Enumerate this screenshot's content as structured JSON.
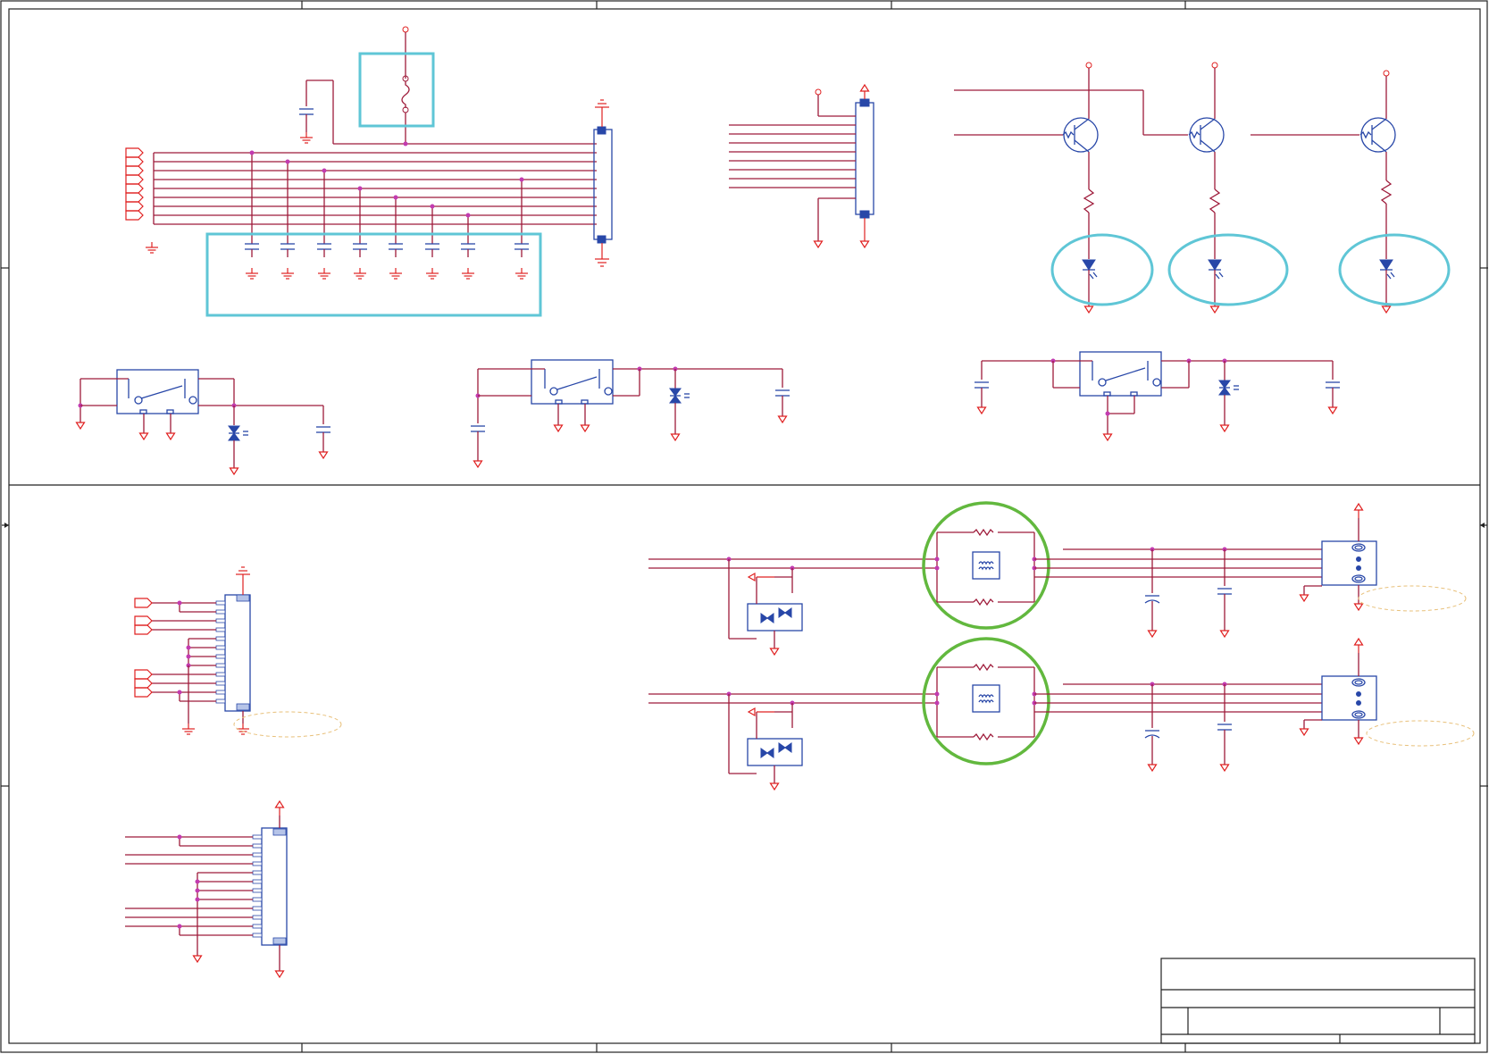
{
  "diagram": {
    "kind": "electrical-schematic",
    "colors": {
      "wire": "#9e1b3a",
      "power_symbol": "#e02020",
      "component": "#2847a8",
      "junction": "#c23bb0",
      "highlight_box": "#5fc6d6",
      "highlight_circle": "#62b83e",
      "frame": "#222222"
    },
    "highlights": {
      "cyan_boxes": 2,
      "cyan_ellipses": 3,
      "green_circles": 2
    },
    "blocks": [
      "connector-with-fuse-and-decoupling-caps",
      "ribbon-connector",
      "led-driver-transistors",
      "pushbutton-switch-1",
      "pushbutton-switch-2",
      "pushbutton-switch-3",
      "side-connector",
      "bottom-connector",
      "differential-filter-1",
      "differential-filter-2"
    ],
    "title_block": {
      "text": ""
    }
  }
}
